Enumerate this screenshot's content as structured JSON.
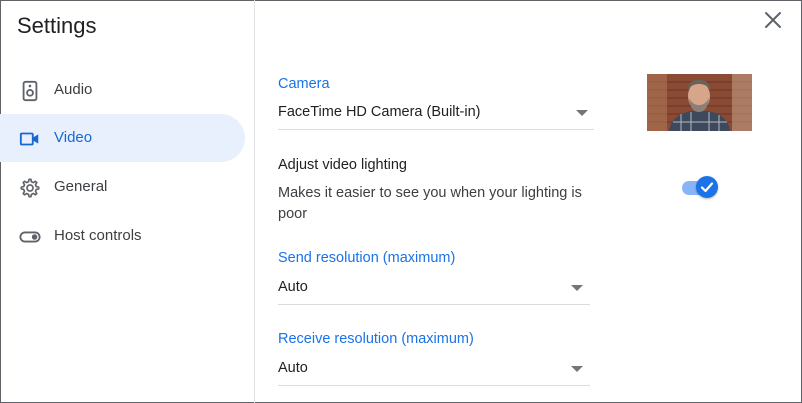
{
  "sidebar": {
    "title": "Settings",
    "items": [
      {
        "label": "Audio",
        "icon": "speaker-icon",
        "active": false
      },
      {
        "label": "Video",
        "icon": "videocam-icon",
        "active": true
      },
      {
        "label": "General",
        "icon": "gear-icon",
        "active": false
      },
      {
        "label": "Host controls",
        "icon": "toggle-icon",
        "active": false
      }
    ]
  },
  "camera": {
    "label": "Camera",
    "value": "FaceTime HD Camera (Built-in)"
  },
  "lighting": {
    "title": "Adjust video lighting",
    "description": "Makes it easier to see you when your lighting is poor",
    "enabled": true
  },
  "send_resolution": {
    "label": "Send resolution (maximum)",
    "value": "Auto"
  },
  "receive_resolution": {
    "label": "Receive resolution (maximum)",
    "value": "Auto"
  },
  "colors": {
    "accent": "#1a73e8",
    "active_bg": "#e8f0fe"
  }
}
